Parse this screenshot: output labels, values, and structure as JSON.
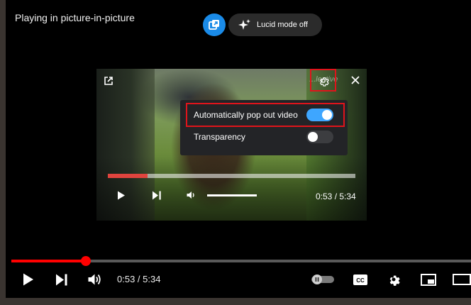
{
  "overlay": {
    "status_text": "Playing in picture-in-picture",
    "lucid_label": "Lucid mode off"
  },
  "mini_player": {
    "watermark": "...lective",
    "time": "0:53 / 5:34",
    "progress_fraction": 0.16,
    "settings": {
      "rows": [
        {
          "label": "Automatically pop out video",
          "enabled": true
        },
        {
          "label": "Transparency",
          "enabled": false
        }
      ]
    }
  },
  "main_player": {
    "time": "0:53 / 5:34",
    "progress_fraction": 0.16
  },
  "colors": {
    "accent": "#1a8be8",
    "toggle_on": "#3ea6ff",
    "progress": "#ff0000",
    "highlight_box": "#e0141b"
  },
  "icons": [
    "pip-icon",
    "sparkles-icon",
    "open-in-new-icon",
    "gear-icon",
    "close-icon",
    "play-icon",
    "skip-next-icon",
    "volume-icon",
    "autoplay-toggle-icon",
    "captions-icon",
    "miniplayer-icon",
    "theater-icon"
  ]
}
